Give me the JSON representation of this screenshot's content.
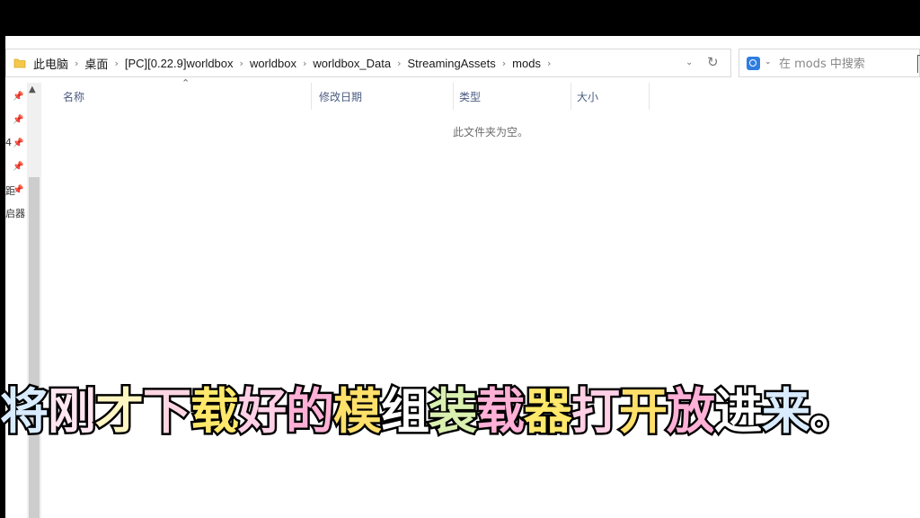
{
  "window": {
    "breadcrumbs": [
      "此电脑",
      "桌面",
      "[PC][0.22.9]worldbox",
      "worldbox",
      "worldbox_Data",
      "StreamingAssets",
      "mods"
    ],
    "separator": "›",
    "refresh_icon": "↻",
    "dropdown_icon": "⌄",
    "search": {
      "placeholder": "在 mods 中搜索",
      "chevron": "⌄"
    }
  },
  "columns": [
    "名称",
    "修改日期",
    "类型",
    "大小"
  ],
  "sort_indicator": "⌃",
  "empty_message": "此文件夹为空。",
  "nav": {
    "pin_icon": "📌",
    "fragments": [
      "4",
      "距",
      "启器"
    ],
    "scroll_up": "▲"
  },
  "caption": {
    "text": "将刚才下载好的模组装载器打开放进来。",
    "colors": [
      "#d9ecff",
      "#ffe6f0",
      "#fff6c2",
      "#ffd5e3",
      "#ffe86b",
      "#ffd0e6",
      "#ffb0d6",
      "#ffe06a",
      "#ffffff",
      "#d9f0b0",
      "#ffb0d6",
      "#ffe86b",
      "#ffd0e6",
      "#ffe06a",
      "#ffb0d6",
      "#ffffff",
      "#d9ecff",
      "#ffffff"
    ]
  }
}
